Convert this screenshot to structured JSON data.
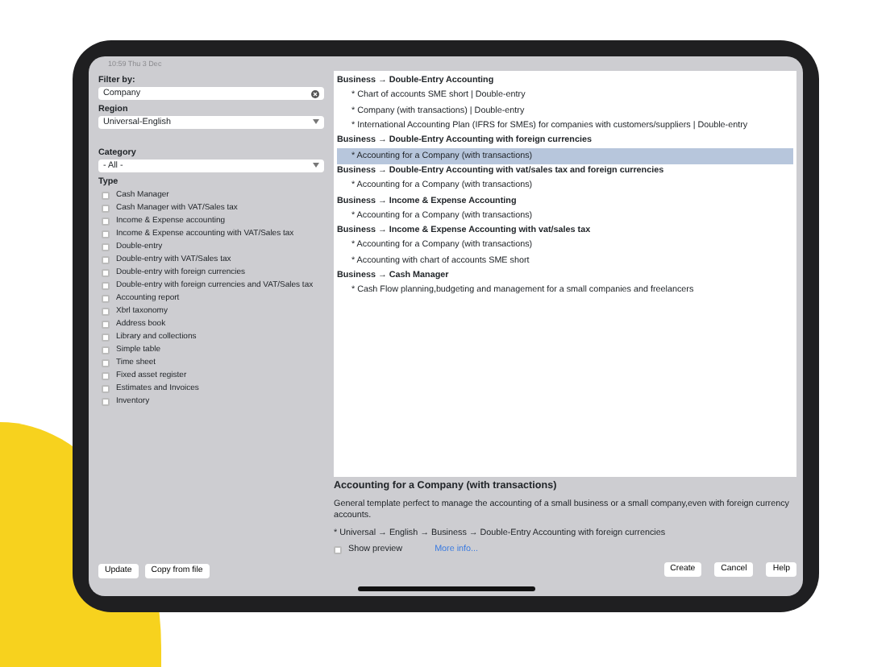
{
  "status_bar": {
    "time": "10:59 Thu 3 Dec"
  },
  "filter": {
    "label": "Filter by:",
    "value": "Company"
  },
  "region": {
    "label": "Region",
    "value": "Universal-English"
  },
  "category": {
    "label": "Category",
    "value": "- All -"
  },
  "type": {
    "label": "Type",
    "items": [
      {
        "label": "Cash Manager",
        "checked": false
      },
      {
        "label": "Cash Manager with VAT/Sales tax",
        "checked": false
      },
      {
        "label": "Income & Expense accounting",
        "checked": false
      },
      {
        "label": "Income & Expense accounting with VAT/Sales tax",
        "checked": false
      },
      {
        "label": "Double-entry",
        "checked": false
      },
      {
        "label": "Double-entry with VAT/Sales tax",
        "checked": false
      },
      {
        "label": "Double-entry with foreign currencies",
        "checked": false
      },
      {
        "label": "Double-entry with foreign currencies and VAT/Sales tax",
        "checked": false
      },
      {
        "label": "Accounting report",
        "checked": false
      },
      {
        "label": "Xbrl taxonomy",
        "checked": false
      },
      {
        "label": "Address book",
        "checked": false
      },
      {
        "label": "Library and collections",
        "checked": false
      },
      {
        "label": "Simple table",
        "checked": false
      },
      {
        "label": "Time sheet",
        "checked": false
      },
      {
        "label": "Fixed asset register",
        "checked": false
      },
      {
        "label": "Estimates and Invoices",
        "checked": false
      },
      {
        "label": "Inventory",
        "checked": false
      }
    ]
  },
  "left_buttons": [
    "Update",
    "Copy from file"
  ],
  "templates": [
    {
      "title": "Business → Double-Entry Accounting",
      "children": [
        {
          "label": "* Chart of accounts SME short | Double-entry",
          "selected": false
        },
        {
          "label": "* Company (with transactions) | Double-entry",
          "selected": false
        },
        {
          "label": "* International Accounting Plan (IFRS for SMEs) for companies with customers/suppliers | Double-entry",
          "selected": false
        }
      ]
    },
    {
      "title": "Business → Double-Entry Accounting with foreign currencies",
      "children": [
        {
          "label": "* Accounting for a Company (with transactions)",
          "selected": true
        }
      ]
    },
    {
      "title": "Business → Double-Entry Accounting with vat/sales tax and foreign currencies",
      "children": [
        {
          "label": "* Accounting for a Company  (with transactions)",
          "selected": false
        }
      ]
    },
    {
      "title": "Business → Income & Expense Accounting",
      "children": [
        {
          "label": "* Accounting for a Company (with transactions)",
          "selected": false
        }
      ]
    },
    {
      "title": "Business → Income & Expense Accounting with vat/sales tax",
      "children": [
        {
          "label": "* Accounting for a Company  (with transactions)",
          "selected": false
        },
        {
          "label": "* Accounting with chart of accounts SME short",
          "selected": false
        }
      ]
    },
    {
      "title": "Business → Cash Manager",
      "children": [
        {
          "label": "* Cash Flow planning,budgeting and management for a small companies and freelancers",
          "selected": false
        }
      ]
    }
  ],
  "detail": {
    "title": "Accounting for a Company (with transactions)",
    "description": "General template perfect to manage the accounting of a small business or a small company,even with foreign currency accounts.",
    "path": "* Universal → English → Business → Double-Entry Accounting with foreign currencies",
    "show_preview": {
      "label": "Show preview",
      "checked": false
    },
    "more_info": "More info..."
  },
  "buttons": [
    "Create",
    "Cancel",
    "Help"
  ]
}
